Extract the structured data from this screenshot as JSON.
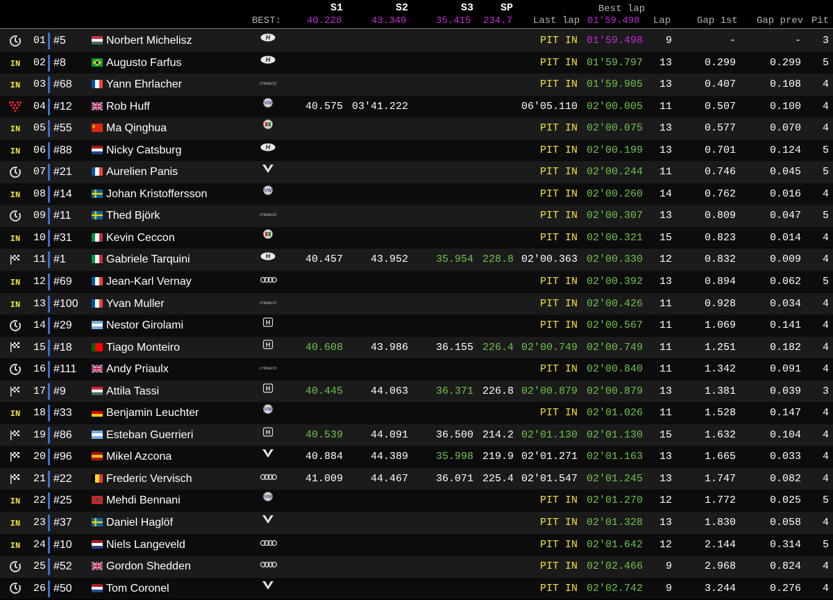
{
  "header": {
    "best_label": "BEST:",
    "col_s1": "S1",
    "best_s1": "40.228",
    "col_s2": "S2",
    "best_s2": "43.349",
    "col_s3": "S3",
    "best_s3": "35.415",
    "col_sp": "SP",
    "best_sp": "234.7",
    "col_last": "Last lap",
    "col_best": "Best lap",
    "best_best": "01'59.498",
    "col_lap": "Lap",
    "col_gap1": "Gap 1st",
    "col_gapp": "Gap prev",
    "col_pit": "Pit"
  },
  "colors": {
    "yellow": "#f2e23c",
    "green": "#6ec54a",
    "purple": "#c32bd6",
    "white": "#ffffff",
    "accent_bar": "#3a6fd8"
  },
  "status_icons": {
    "garage": "garage-icon",
    "in": "pit-in-text",
    "checkered": "checkered-flag-icon",
    "heart": "heart-icon"
  },
  "rows": [
    {
      "status": "garage",
      "pos": "01",
      "num": "#5",
      "flag": "HU",
      "driver": "Norbert Michelisz",
      "make": "hyundai",
      "s1": "",
      "s2": "",
      "s3": "",
      "sp": "",
      "last": "PIT IN",
      "last_c": "yellow",
      "best": "01'59.498",
      "best_c": "purple",
      "lap": "9",
      "gap1": "-",
      "gapp": "-",
      "pit": "3"
    },
    {
      "status": "in",
      "pos": "02",
      "num": "#8",
      "flag": "BR",
      "driver": "Augusto Farfus",
      "make": "hyundai",
      "s1": "",
      "s2": "",
      "s3": "",
      "sp": "",
      "last": "PIT IN",
      "last_c": "yellow",
      "best": "01'59.797",
      "best_c": "green",
      "lap": "13",
      "gap1": "0.299",
      "gapp": "0.299",
      "pit": "5"
    },
    {
      "status": "in",
      "pos": "03",
      "num": "#68",
      "flag": "FR",
      "driver": "Yann Ehrlacher",
      "make": "lynkco",
      "s1": "",
      "s2": "",
      "s3": "",
      "sp": "",
      "last": "PIT IN",
      "last_c": "yellow",
      "best": "01'59.905",
      "best_c": "green",
      "lap": "13",
      "gap1": "0.407",
      "gapp": "0.108",
      "pit": "4"
    },
    {
      "status": "heart",
      "pos": "04",
      "num": "#12",
      "flag": "GB",
      "driver": "Rob Huff",
      "make": "vw",
      "s1": "40.575",
      "s1_c": "white",
      "s2": "03'41.222",
      "s2_c": "white",
      "s3": "",
      "sp": "",
      "last": "06'05.110",
      "last_c": "white",
      "best": "02'00.005",
      "best_c": "green",
      "lap": "11",
      "gap1": "0.507",
      "gapp": "0.100",
      "pit": "4"
    },
    {
      "status": "in",
      "pos": "05",
      "num": "#55",
      "flag": "CN",
      "driver": "Ma Qinghua",
      "make": "alfa",
      "s1": "",
      "s2": "",
      "s3": "",
      "sp": "",
      "last": "PIT IN",
      "last_c": "yellow",
      "best": "02'00.075",
      "best_c": "green",
      "lap": "13",
      "gap1": "0.577",
      "gapp": "0.070",
      "pit": "4"
    },
    {
      "status": "in",
      "pos": "06",
      "num": "#88",
      "flag": "NL",
      "driver": "Nicky Catsburg",
      "make": "hyundai",
      "s1": "",
      "s2": "",
      "s3": "",
      "sp": "",
      "last": "PIT IN",
      "last_c": "yellow",
      "best": "02'00.199",
      "best_c": "green",
      "lap": "13",
      "gap1": "0.701",
      "gapp": "0.124",
      "pit": "5"
    },
    {
      "status": "garage",
      "pos": "07",
      "num": "#21",
      "flag": "FR",
      "driver": "Aurelien Panis",
      "make": "cupra",
      "s1": "",
      "s2": "",
      "s3": "",
      "sp": "",
      "last": "PIT IN",
      "last_c": "yellow",
      "best": "02'00.244",
      "best_c": "green",
      "lap": "11",
      "gap1": "0.746",
      "gapp": "0.045",
      "pit": "5"
    },
    {
      "status": "in",
      "pos": "08",
      "num": "#14",
      "flag": "SE",
      "driver": "Johan Kristoffersson",
      "make": "vw",
      "s1": "",
      "s2": "",
      "s3": "",
      "sp": "",
      "last": "PIT IN",
      "last_c": "yellow",
      "best": "02'00.260",
      "best_c": "green",
      "lap": "14",
      "gap1": "0.762",
      "gapp": "0.016",
      "pit": "4"
    },
    {
      "status": "garage",
      "pos": "09",
      "num": "#11",
      "flag": "SE",
      "driver": "Thed Björk",
      "make": "lynkco",
      "s1": "",
      "s2": "",
      "s3": "",
      "sp": "",
      "last": "PIT IN",
      "last_c": "yellow",
      "best": "02'00.307",
      "best_c": "green",
      "lap": "13",
      "gap1": "0.809",
      "gapp": "0.047",
      "pit": "5"
    },
    {
      "status": "in",
      "pos": "10",
      "num": "#31",
      "flag": "IT",
      "driver": "Kevin Ceccon",
      "make": "alfa",
      "s1": "",
      "s2": "",
      "s3": "",
      "sp": "",
      "last": "PIT IN",
      "last_c": "yellow",
      "best": "02'00.321",
      "best_c": "green",
      "lap": "15",
      "gap1": "0.823",
      "gapp": "0.014",
      "pit": "4"
    },
    {
      "status": "checkered",
      "pos": "11",
      "num": "#1",
      "flag": "IT",
      "driver": "Gabriele Tarquini",
      "make": "hyundai",
      "s1": "40.457",
      "s1_c": "white",
      "s2": "43.952",
      "s2_c": "white",
      "s3": "35.954",
      "s3_c": "green",
      "sp": "228.8",
      "sp_c": "green",
      "last": "02'00.363",
      "last_c": "white",
      "best": "02'00.330",
      "best_c": "green",
      "lap": "12",
      "gap1": "0.832",
      "gapp": "0.009",
      "pit": "4"
    },
    {
      "status": "in",
      "pos": "12",
      "num": "#69",
      "flag": "FR",
      "driver": "Jean-Karl Vernay",
      "make": "audi",
      "s1": "",
      "s2": "",
      "s3": "",
      "sp": "",
      "last": "PIT IN",
      "last_c": "yellow",
      "best": "02'00.392",
      "best_c": "green",
      "lap": "13",
      "gap1": "0.894",
      "gapp": "0.062",
      "pit": "5"
    },
    {
      "status": "in",
      "pos": "13",
      "num": "#100",
      "flag": "FR",
      "driver": "Yvan Muller",
      "make": "lynkco",
      "s1": "",
      "s2": "",
      "s3": "",
      "sp": "",
      "last": "PIT IN",
      "last_c": "yellow",
      "best": "02'00.426",
      "best_c": "green",
      "lap": "11",
      "gap1": "0.928",
      "gapp": "0.034",
      "pit": "4"
    },
    {
      "status": "garage",
      "pos": "14",
      "num": "#29",
      "flag": "AR",
      "driver": "Nestor Girolami",
      "make": "honda",
      "s1": "",
      "s2": "",
      "s3": "",
      "sp": "",
      "last": "PIT IN",
      "last_c": "yellow",
      "best": "02'00.567",
      "best_c": "green",
      "lap": "11",
      "gap1": "1.069",
      "gapp": "0.141",
      "pit": "4"
    },
    {
      "status": "checkered",
      "pos": "15",
      "num": "#18",
      "flag": "PT",
      "driver": "Tiago Monteiro",
      "make": "honda",
      "s1": "40.608",
      "s1_c": "green",
      "s2": "43.986",
      "s2_c": "white",
      "s3": "36.155",
      "s3_c": "white",
      "sp": "226.4",
      "sp_c": "green",
      "last": "02'00.749",
      "last_c": "green",
      "best": "02'00.749",
      "best_c": "green",
      "lap": "11",
      "gap1": "1.251",
      "gapp": "0.182",
      "pit": "4"
    },
    {
      "status": "garage",
      "pos": "16",
      "num": "#111",
      "flag": "GB",
      "driver": "Andy Priaulx",
      "make": "lynkco",
      "s1": "",
      "s2": "",
      "s3": "",
      "sp": "",
      "last": "PIT IN",
      "last_c": "yellow",
      "best": "02'00.840",
      "best_c": "green",
      "lap": "11",
      "gap1": "1.342",
      "gapp": "0.091",
      "pit": "4"
    },
    {
      "status": "checkered",
      "pos": "17",
      "num": "#9",
      "flag": "HU",
      "driver": "Attila Tassi",
      "make": "honda",
      "s1": "40.445",
      "s1_c": "green",
      "s2": "44.063",
      "s2_c": "white",
      "s3": "36.371",
      "s3_c": "green",
      "sp": "226.8",
      "sp_c": "white",
      "last": "02'00.879",
      "last_c": "green",
      "best": "02'00.879",
      "best_c": "green",
      "lap": "13",
      "gap1": "1.381",
      "gapp": "0.039",
      "pit": "3"
    },
    {
      "status": "in",
      "pos": "18",
      "num": "#33",
      "flag": "DE",
      "driver": "Benjamin Leuchter",
      "make": "vw",
      "s1": "",
      "s2": "",
      "s3": "",
      "sp": "",
      "last": "PIT IN",
      "last_c": "yellow",
      "best": "02'01.026",
      "best_c": "green",
      "lap": "11",
      "gap1": "1.528",
      "gapp": "0.147",
      "pit": "4"
    },
    {
      "status": "checkered",
      "pos": "19",
      "num": "#86",
      "flag": "AR",
      "driver": "Esteban Guerrieri",
      "make": "honda",
      "s1": "40.539",
      "s1_c": "green",
      "s2": "44.091",
      "s2_c": "white",
      "s3": "36.500",
      "s3_c": "white",
      "sp": "214.2",
      "sp_c": "white",
      "last": "02'01.130",
      "last_c": "green",
      "best": "02'01.130",
      "best_c": "green",
      "lap": "15",
      "gap1": "1.632",
      "gapp": "0.104",
      "pit": "4"
    },
    {
      "status": "checkered",
      "pos": "20",
      "num": "#96",
      "flag": "ES",
      "driver": "Mikel Azcona",
      "make": "cupra",
      "s1": "40.884",
      "s1_c": "white",
      "s2": "44.389",
      "s2_c": "white",
      "s3": "35.998",
      "s3_c": "green",
      "sp": "219.9",
      "sp_c": "white",
      "last": "02'01.271",
      "last_c": "white",
      "best": "02'01.163",
      "best_c": "green",
      "lap": "13",
      "gap1": "1.665",
      "gapp": "0.033",
      "pit": "4"
    },
    {
      "status": "checkered",
      "pos": "21",
      "num": "#22",
      "flag": "BE",
      "driver": "Frederic Vervisch",
      "make": "audi",
      "s1": "41.009",
      "s1_c": "white",
      "s2": "44.467",
      "s2_c": "white",
      "s3": "36.071",
      "s3_c": "white",
      "sp": "225.4",
      "sp_c": "white",
      "last": "02'01.547",
      "last_c": "white",
      "best": "02'01.245",
      "best_c": "green",
      "lap": "13",
      "gap1": "1.747",
      "gapp": "0.082",
      "pit": "4"
    },
    {
      "status": "in",
      "pos": "22",
      "num": "#25",
      "flag": "MA",
      "driver": "Mehdi Bennani",
      "make": "vw",
      "s1": "",
      "s2": "",
      "s3": "",
      "sp": "",
      "last": "PIT IN",
      "last_c": "yellow",
      "best": "02'01.270",
      "best_c": "green",
      "lap": "12",
      "gap1": "1.772",
      "gapp": "0.025",
      "pit": "5"
    },
    {
      "status": "in",
      "pos": "23",
      "num": "#37",
      "flag": "SE",
      "driver": "Daniel Haglöf",
      "make": "cupra",
      "s1": "",
      "s2": "",
      "s3": "",
      "sp": "",
      "last": "PIT IN",
      "last_c": "yellow",
      "best": "02'01.328",
      "best_c": "green",
      "lap": "13",
      "gap1": "1.830",
      "gapp": "0.058",
      "pit": "4"
    },
    {
      "status": "in",
      "pos": "24",
      "num": "#10",
      "flag": "NL",
      "driver": "Niels Langeveld",
      "make": "audi",
      "s1": "",
      "s2": "",
      "s3": "",
      "sp": "",
      "last": "PIT IN",
      "last_c": "yellow",
      "best": "02'01.642",
      "best_c": "green",
      "lap": "12",
      "gap1": "2.144",
      "gapp": "0.314",
      "pit": "5"
    },
    {
      "status": "garage",
      "pos": "25",
      "num": "#52",
      "flag": "GB",
      "driver": "Gordon Shedden",
      "make": "audi",
      "s1": "",
      "s2": "",
      "s3": "",
      "sp": "",
      "last": "PIT IN",
      "last_c": "yellow",
      "best": "02'02.466",
      "best_c": "green",
      "lap": "9",
      "gap1": "2.968",
      "gapp": "0.824",
      "pit": "4"
    },
    {
      "status": "garage",
      "pos": "26",
      "num": "#50",
      "flag": "NL",
      "driver": "Tom Coronel",
      "make": "cupra",
      "s1": "",
      "s2": "",
      "s3": "",
      "sp": "",
      "last": "PIT IN",
      "last_c": "yellow",
      "best": "02'02.742",
      "best_c": "green",
      "lap": "9",
      "gap1": "3.244",
      "gapp": "0.276",
      "pit": "4"
    }
  ]
}
